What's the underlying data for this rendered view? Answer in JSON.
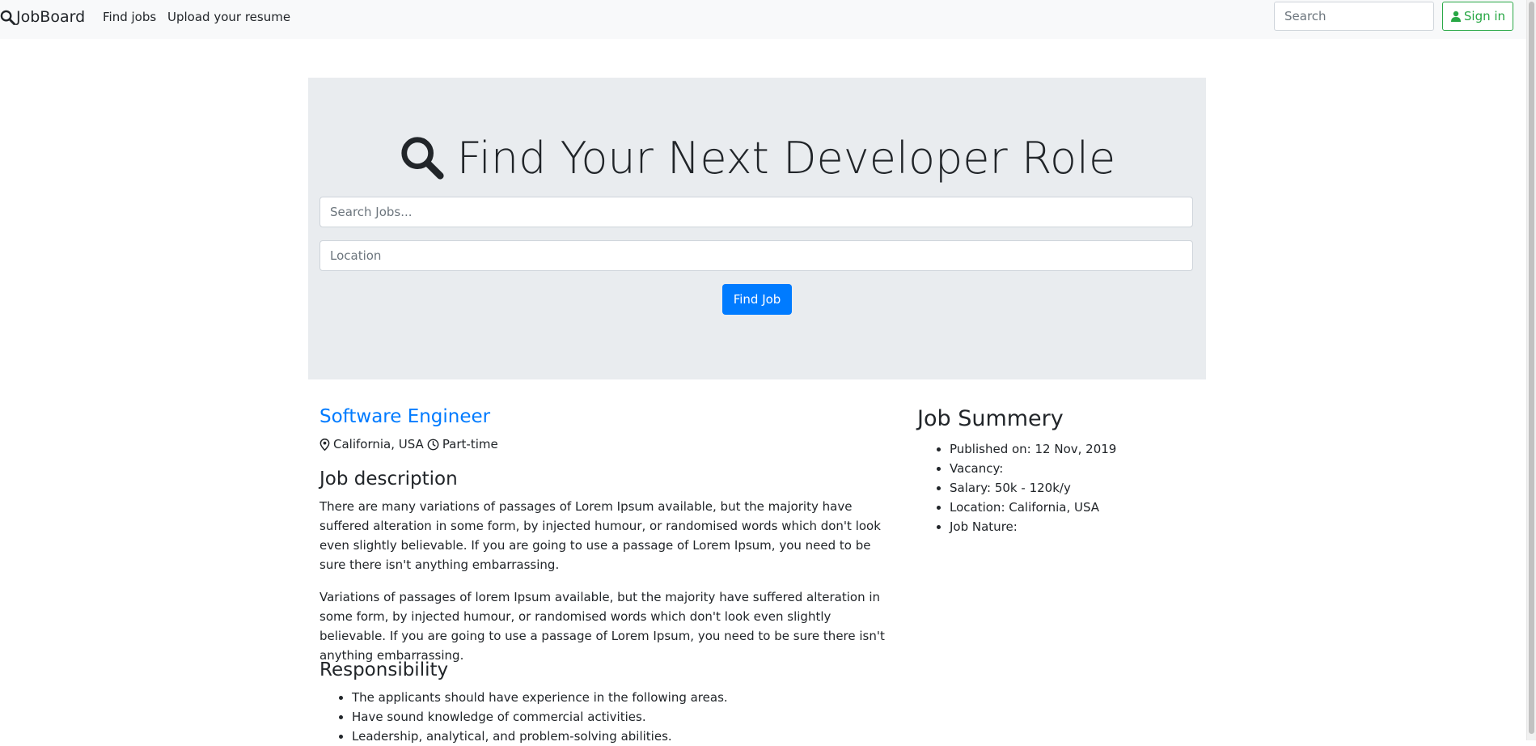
{
  "navbar": {
    "brand": "JobBoard",
    "links": [
      "Find jobs",
      "Upload your resume"
    ],
    "search_placeholder": "Search",
    "signin_label": "Sign in"
  },
  "hero": {
    "heading": "Find Your Next Developer Role",
    "search_placeholder": "Search Jobs...",
    "location_placeholder": "Location",
    "button_label": "Find Job"
  },
  "job": {
    "title": "Software Engineer",
    "location": "California, USA",
    "type": "Part-time",
    "description_heading": "Job description",
    "description": [
      "There are many variations of passages of Lorem Ipsum available, but the majority have suffered alteration in some form, by injected humour, or randomised words which don't look even slightly believable. If you are going to use a passage of Lorem Ipsum, you need to be sure there isn't anything embarrassing.",
      "Variations of passages of lorem Ipsum available, but the majority have suffered alteration in some form, by injected humour, or randomised words which don't look even slightly believable. If you are going to use a passage of Lorem Ipsum, you need to be sure there isn't anything embarrassing."
    ],
    "responsibility_heading": "Responsibility",
    "responsibilities": [
      "The applicants should have experience in the following areas.",
      "Have sound knowledge of commercial activities.",
      "Leadership, analytical, and problem-solving abilities."
    ]
  },
  "summary": {
    "heading": "Job Summery",
    "items": [
      "Published on: 12 Nov, 2019",
      "Vacancy:",
      "Salary: 50k - 120k/y",
      "Location: California, USA",
      "Job Nature:"
    ]
  },
  "colors": {
    "link": "#007bff",
    "success": "#28a745",
    "hero_bg": "#e9ecef",
    "navbar_bg": "#f8f9fa"
  },
  "icons": [
    "search-icon",
    "user-icon",
    "map-marker-icon",
    "clock-icon"
  ]
}
